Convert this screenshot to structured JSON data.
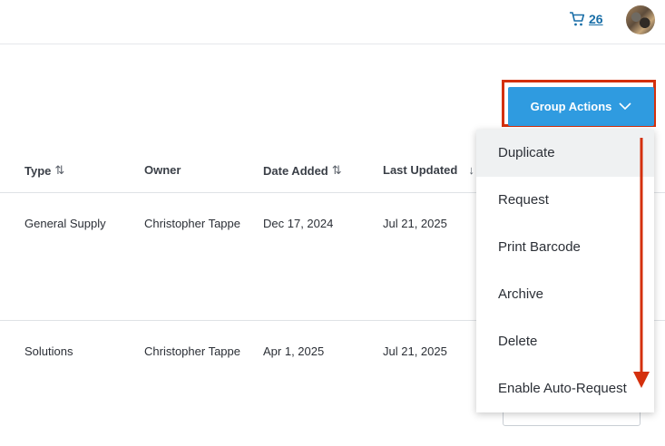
{
  "topbar": {
    "cart_count": "26"
  },
  "group_actions": {
    "label": "Group Actions",
    "menu": [
      "Duplicate",
      "Request",
      "Print Barcode",
      "Archive",
      "Delete",
      "Enable Auto-Request"
    ]
  },
  "table": {
    "headers": {
      "type": "Type",
      "owner": "Owner",
      "date_added": "Date Added",
      "last_updated": "Last Updated"
    },
    "rows": [
      {
        "type": "General Supply",
        "owner": "Christopher Tappe",
        "date_added": "Dec 17, 2024",
        "last_updated": "Jul 21, 2025"
      },
      {
        "type": "Solutions",
        "owner": "Christopher Tappe",
        "date_added": "Apr 1, 2025",
        "last_updated": "Jul 21, 2025"
      }
    ]
  },
  "colors": {
    "accent": "#2f9be0",
    "highlight": "#d4300d",
    "link": "#1a6fa8"
  }
}
